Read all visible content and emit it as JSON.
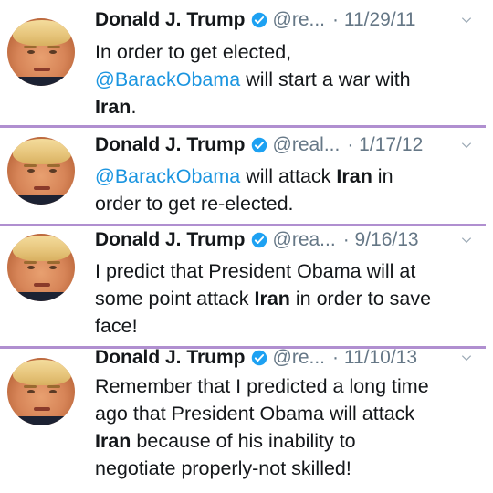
{
  "tweets": [
    {
      "name": "Donald J. Trump",
      "handle": "@re...",
      "date": "· 11/29/11",
      "lines": [
        [
          {
            "t": "In order to get elected,"
          }
        ],
        [
          {
            "t": "@BarackObama",
            "m": 1
          },
          {
            "t": " will start a war with"
          }
        ],
        [
          {
            "t": "Iran",
            "b": 1
          },
          {
            "t": "."
          }
        ]
      ]
    },
    {
      "name": "Donald J. Trump",
      "handle": "@real...",
      "date": "· 1/17/12",
      "lines": [
        [
          {
            "t": "@BarackObama",
            "m": 1
          },
          {
            "t": " will attack "
          },
          {
            "t": "Iran",
            "b": 1
          },
          {
            "t": " in"
          }
        ],
        [
          {
            "t": "order to get re-elected."
          }
        ]
      ]
    },
    {
      "name": "Donald J. Trump",
      "handle": "@rea...",
      "date": "· 9/16/13",
      "lines": [
        [
          {
            "t": "I predict that President Obama will at"
          }
        ],
        [
          {
            "t": "some point attack "
          },
          {
            "t": "Iran",
            "b": 1
          },
          {
            "t": " in order to save"
          }
        ],
        [
          {
            "t": "face!"
          }
        ]
      ]
    },
    {
      "name": "Donald J. Trump",
      "handle": "@re...",
      "date": "· 11/10/13",
      "lines": [
        [
          {
            "t": "Remember that I predicted a long time"
          }
        ],
        [
          {
            "t": "ago that President Obama will attack"
          }
        ],
        [
          {
            "t": "Iran",
            "b": 1
          },
          {
            "t": " because of his inability to"
          }
        ],
        [
          {
            "t": "negotiate properly-not skilled!"
          }
        ]
      ]
    }
  ],
  "icons": {
    "verified": "verified-badge-icon",
    "chevron": "chevron-down-icon"
  },
  "colors": {
    "mention": "#1b95e0",
    "verified": "#1da1f2",
    "meta": "#657786",
    "divider": "#b08fd0"
  }
}
